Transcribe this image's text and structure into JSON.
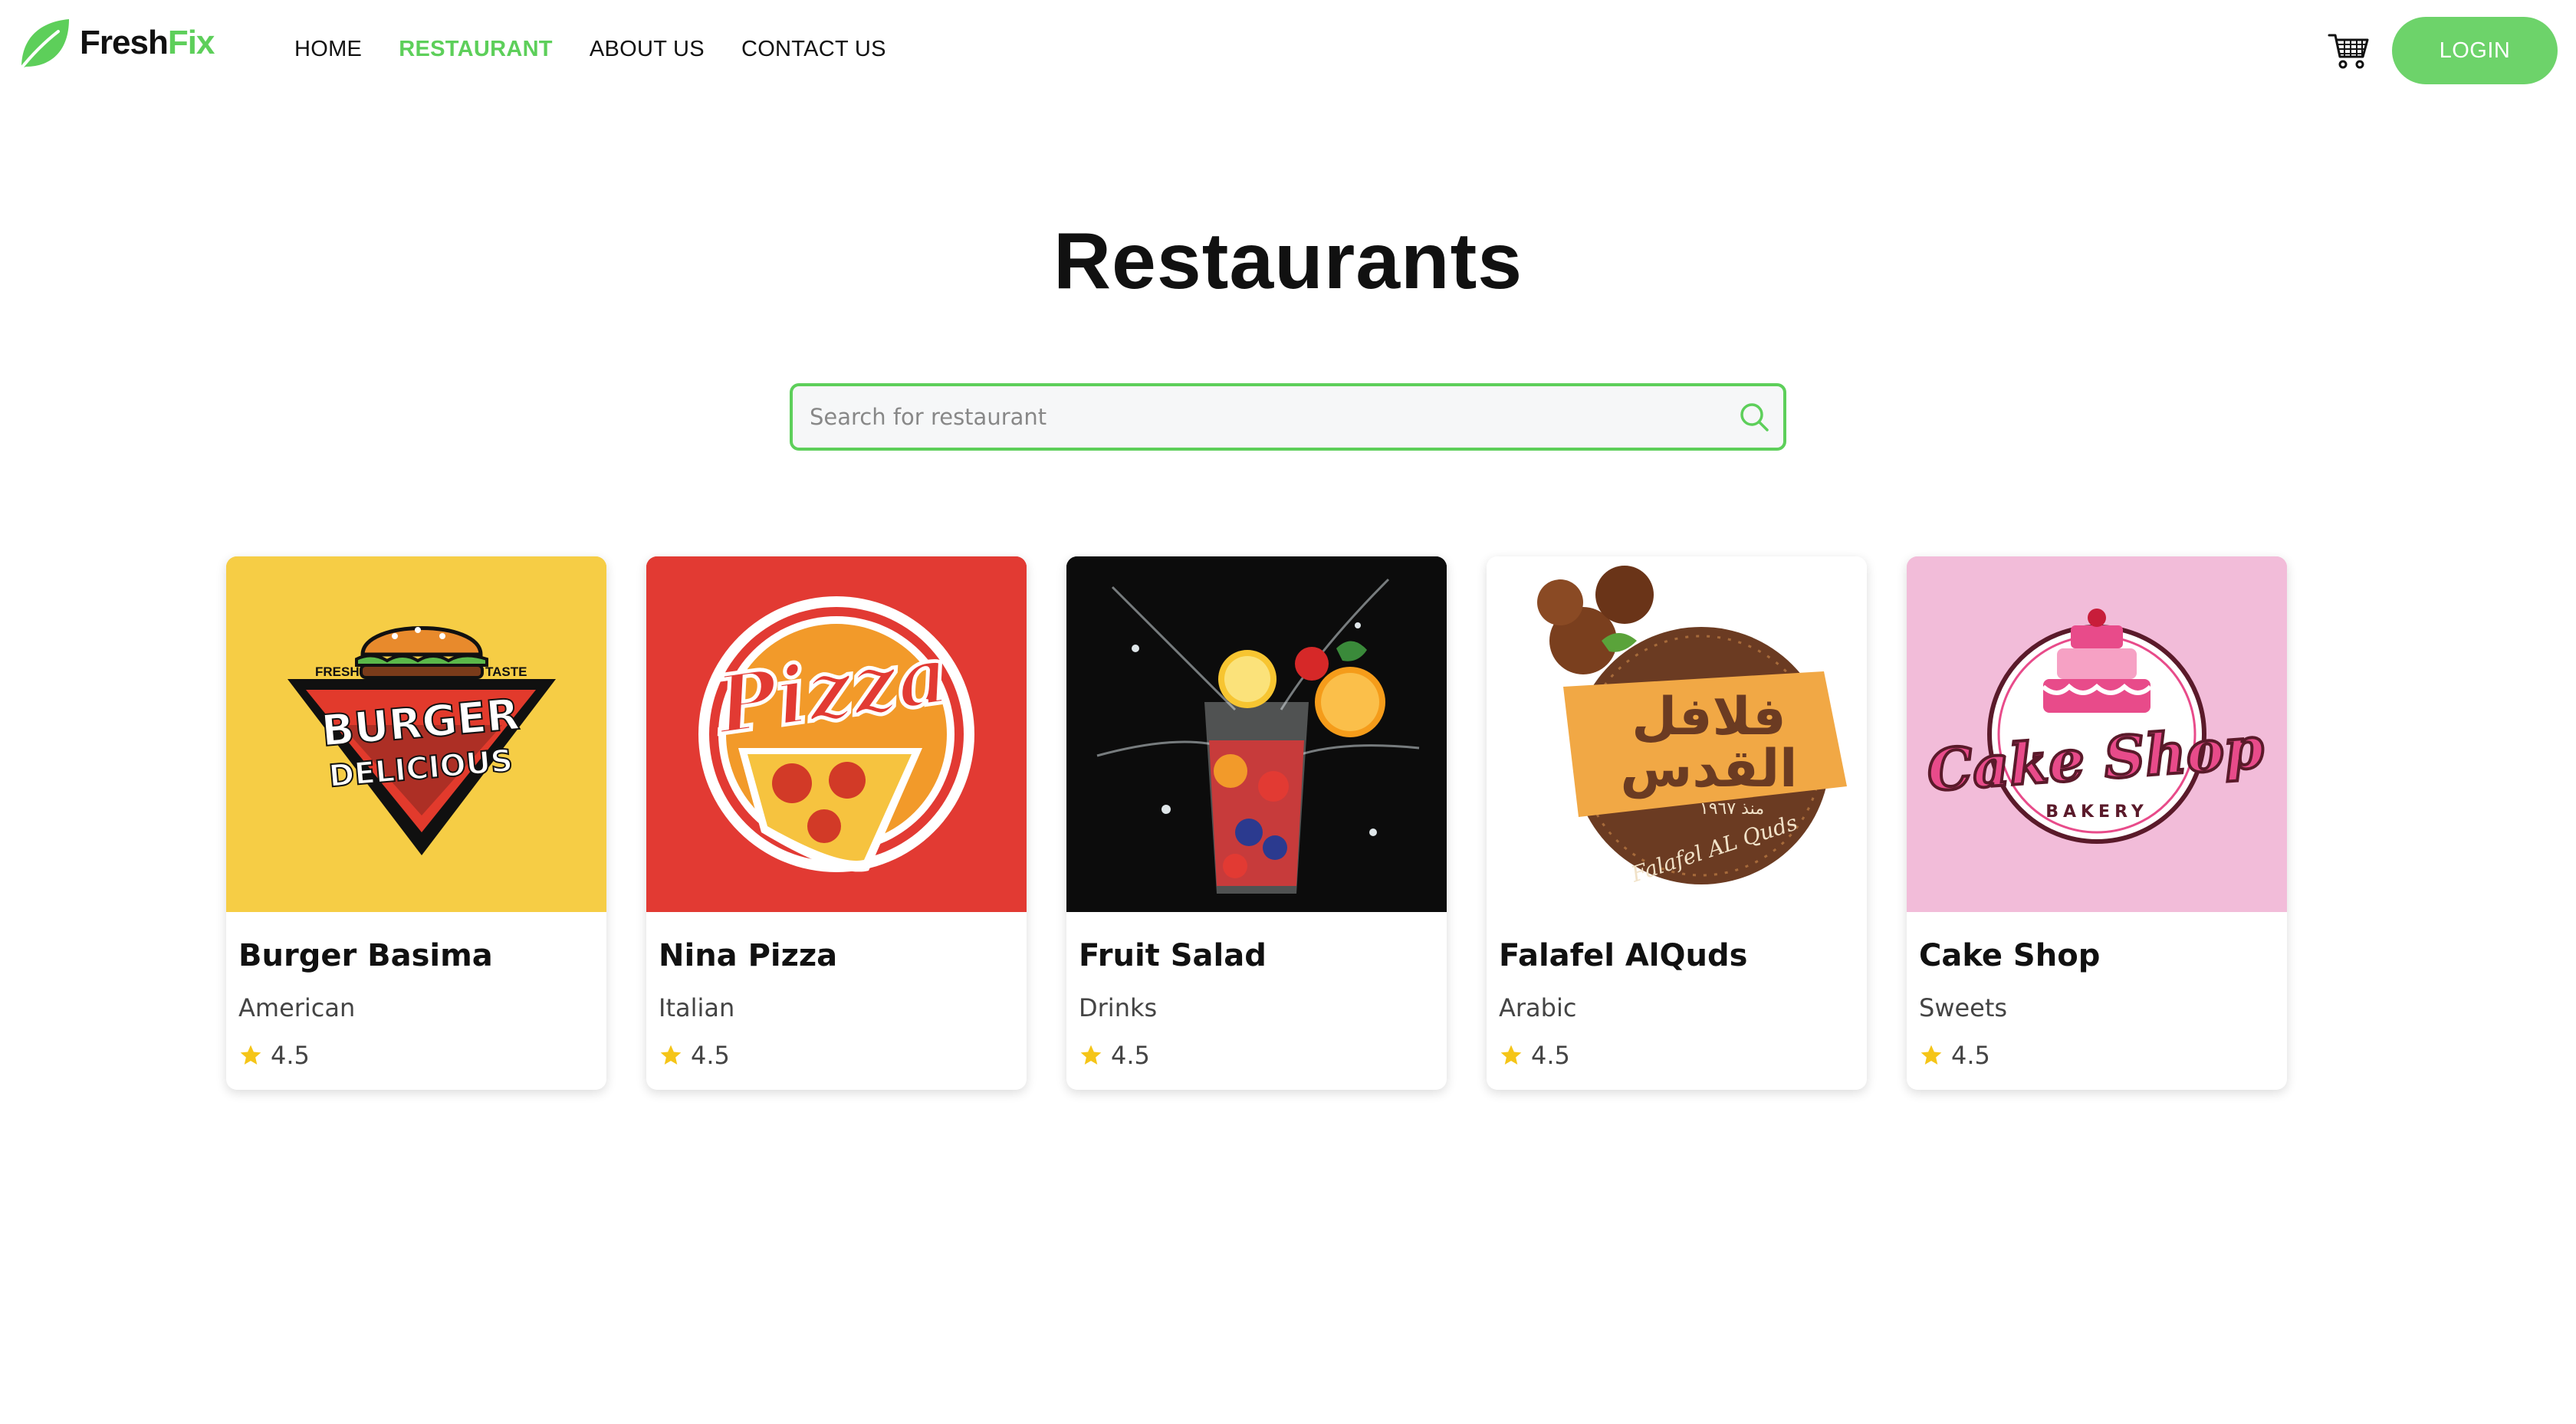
{
  "brand": {
    "part1": "Fresh",
    "part2": "Fix",
    "accent": "#5dcf5a"
  },
  "nav": {
    "items": [
      {
        "label": "HOME",
        "active": false
      },
      {
        "label": "RESTAURANT",
        "active": true
      },
      {
        "label": "ABOUT US",
        "active": false
      },
      {
        "label": "CONTACT US",
        "active": false
      }
    ]
  },
  "header": {
    "cart_icon": "cart-icon",
    "login_label": "LOGIN"
  },
  "page": {
    "title": "Restaurants"
  },
  "search": {
    "placeholder": "Search for restaurant",
    "value": "",
    "icon": "search-icon"
  },
  "restaurants": [
    {
      "name": "Burger Basima",
      "cuisine": "American",
      "rating": "4.5",
      "logo_text": [
        "FRESH",
        "TASTE",
        "BURGER",
        "DELICIOUS"
      ],
      "bg": "#f6cd45"
    },
    {
      "name": "Nina Pizza",
      "cuisine": "Italian",
      "rating": "4.5",
      "logo_text": [
        "Pizza"
      ],
      "bg": "#e23a33"
    },
    {
      "name": "Fruit Salad",
      "cuisine": "Drinks",
      "rating": "4.5",
      "logo_text": [],
      "bg": "#0c0c0c"
    },
    {
      "name": "Falafel AlQuds",
      "cuisine": "Arabic",
      "rating": "4.5",
      "logo_text": [
        "فلافل",
        "القدس",
        "منذ ١٩٦٧",
        "Falafel AL Quds"
      ],
      "bg": "#ffffff"
    },
    {
      "name": "Cake Shop",
      "cuisine": "Sweets",
      "rating": "4.5",
      "logo_text": [
        "Cake Shop",
        "BAKERY"
      ],
      "bg": "#f2bcd9"
    }
  ]
}
